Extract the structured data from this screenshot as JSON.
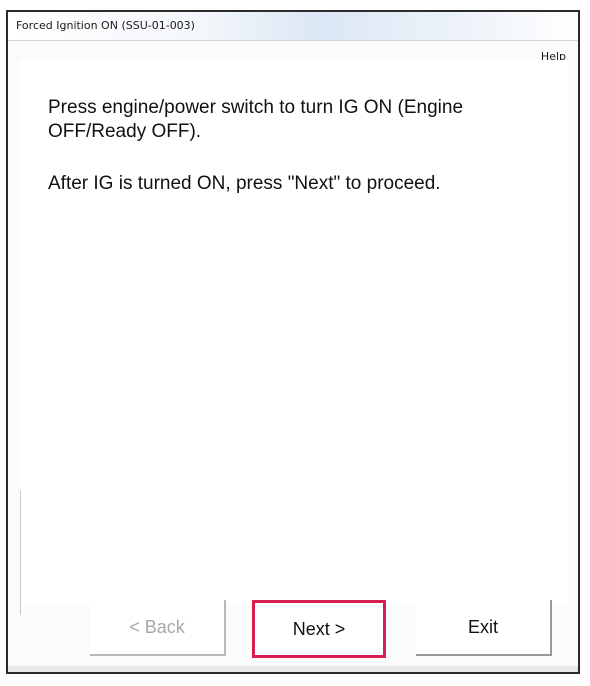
{
  "window": {
    "title": "Forced Ignition ON (SSU-01-003)",
    "help_label": "Help"
  },
  "main": {
    "instruction_1": "Press engine/power switch to turn IG ON (Engine OFF/Ready OFF).",
    "instruction_2": "After IG is turned ON, press \"Next\" to proceed."
  },
  "buttons": {
    "back_label": "< Back",
    "next_label": "Next >",
    "exit_label": "Exit"
  },
  "colors": {
    "highlight": "#d6204f",
    "disabled_text": "#a8a8a8"
  }
}
